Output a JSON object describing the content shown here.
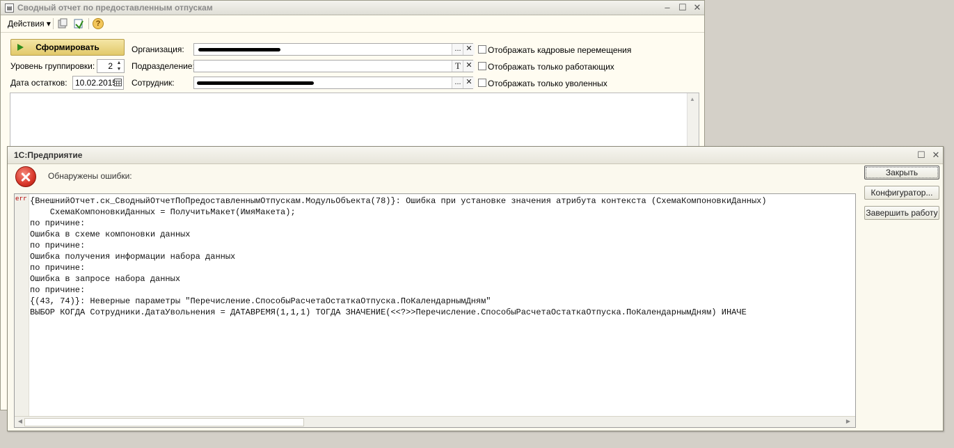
{
  "report_window": {
    "title": "Сводный отчет по предоставленным отпускам",
    "window_controls": {
      "minimize": "–",
      "maximize": "☐",
      "close": "✕"
    },
    "toolbar": {
      "actions_label": "Действия ▾",
      "help_glyph": "?"
    },
    "form_button": "Сформировать",
    "grouping": {
      "label": "Уровень группировки:",
      "value": "2"
    },
    "balance_date": {
      "label": "Дата остатков:",
      "value": "10.02.2015"
    },
    "organization": {
      "label": "Организация:",
      "dots": "...",
      "clear": "✕"
    },
    "department": {
      "label": "Подразделение:",
      "t_button": "T",
      "clear": "✕"
    },
    "employee": {
      "label": "Сотрудник:",
      "dots": "...",
      "clear": "✕"
    },
    "checkboxes": [
      {
        "label": "Отображать кадровые перемещения"
      },
      {
        "label": "Отображать только работающих"
      },
      {
        "label": "Отображать только уволенных"
      }
    ]
  },
  "dialog": {
    "title": "1С:Предприятие",
    "window_controls": {
      "maximize": "☐",
      "close": "✕"
    },
    "message": "Обнаружены ошибки:",
    "buttons": {
      "close": "Закрыть",
      "configurator": "Конфигуратор...",
      "exit": "Завершить работу"
    },
    "marker": "err",
    "error_text": "{ВнешнийОтчет.ск_СводныйОтчетПоПредоставленнымОтпускам.МодульОбъекта(78)}: Ошибка при установке значения атрибута контекста (СхемаКомпоновкиДанных)\n    СхемаКомпоновкиДанных = ПолучитьМакет(ИмяМакета);\nпо причине:\nОшибка в схеме компоновки данных\nпо причине:\nОшибка получения информации набора данных\nпо причине:\nОшибка в запросе набора данных\nпо причине:\n{(43, 74)}: Неверные параметры \"Перечисление.СпособыРасчетаОстаткаОтпуска.ПоКалендарнымДням\"\nВЫБОР КОГДА Сотрудники.ДатаУвольнения = ДАТАВРЕМЯ(1,1,1) ТОГДА ЗНАЧЕНИЕ(<<?>>Перечисление.СпособыРасчетаОстаткаОтпуска.ПоКалендарнымДням) ИНАЧЕ"
  }
}
